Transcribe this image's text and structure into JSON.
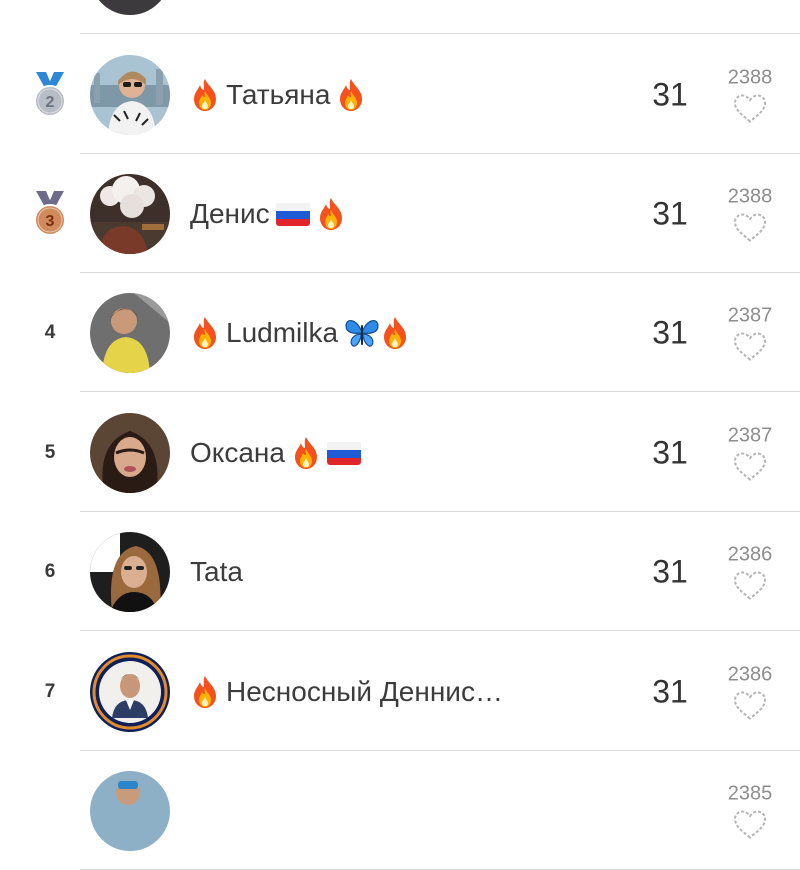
{
  "leaderboard": {
    "rows": [
      {
        "rank": "",
        "name": "",
        "score": "",
        "likes": "",
        "medal": "none",
        "avatar": "top-partial",
        "parts": []
      },
      {
        "rank": "2",
        "name": "Татьяна",
        "score": "31",
        "likes": "2388",
        "medal": "silver",
        "avatar": "woman-sunglasses-city",
        "parts": [
          "fire-emoji",
          "text",
          "fire-emoji"
        ]
      },
      {
        "rank": "3",
        "name": "Денис",
        "score": "31",
        "likes": "2388",
        "medal": "bronze",
        "avatar": "man-smoke-cloud",
        "parts": [
          "text",
          "russian-flag",
          "fire-emoji"
        ]
      },
      {
        "rank": "4",
        "name": "Ludmilka",
        "score": "31",
        "likes": "2387",
        "medal": "none",
        "avatar": "woman-yellow-shirt",
        "parts": [
          "fire-emoji",
          "text",
          "butterfly-emoji",
          "fire-emoji"
        ]
      },
      {
        "rank": "5",
        "name": "Оксана",
        "score": "31",
        "likes": "2387",
        "medal": "none",
        "avatar": "woman-dark-hair-selfie",
        "parts": [
          "text",
          "fire-emoji",
          "russian-flag"
        ]
      },
      {
        "rank": "6",
        "name": "Tata",
        "score": "31",
        "likes": "2386",
        "medal": "none",
        "avatar": "woman-car-selfie",
        "parts": [
          "text"
        ]
      },
      {
        "rank": "7",
        "name": "Несносный Деннис…",
        "score": "31",
        "likes": "2386",
        "medal": "none",
        "avatar": "man-badge-portrait",
        "parts": [
          "fire-emoji",
          "text"
        ]
      },
      {
        "rank": "",
        "name": "",
        "score": "",
        "likes": "2385",
        "medal": "none",
        "avatar": "bottom-partial",
        "parts": []
      }
    ]
  },
  "colors": {
    "divider": "#d9d9d9",
    "silver_medal": "#b8bcc4",
    "bronze_medal": "#d08a5c",
    "ribbon": "#2e86d6",
    "heart_outline": "#b5b5b5"
  }
}
